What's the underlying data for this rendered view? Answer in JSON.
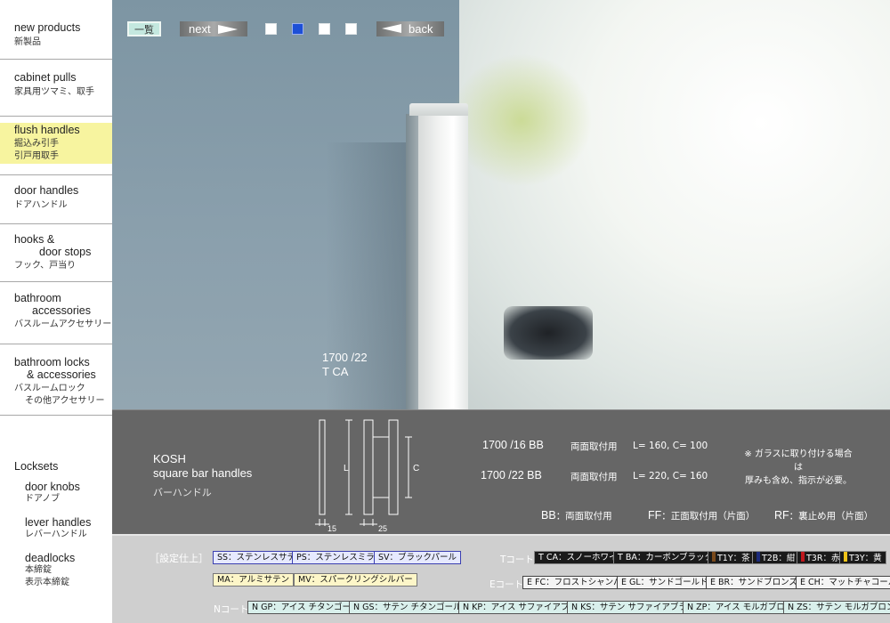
{
  "sidebar": {
    "items": [
      {
        "en": "new products",
        "jp": "新製品"
      },
      {
        "en": "cabinet pulls",
        "jp": "家具用ツマミ、取手"
      },
      {
        "en": "flush handles",
        "jp": "掘込み引手",
        "jp2": "引戸用取手"
      },
      {
        "en": "door handles",
        "jp": "ドアハンドル"
      },
      {
        "en": "hooks &",
        "en2": "door stops",
        "jp": "フック、戸当り"
      },
      {
        "en": "bathroom",
        "en2": "accessories",
        "jp": "バスルームアクセサリー"
      },
      {
        "en": "bathroom locks",
        "en2": "& accessories",
        "jp": "バスルームロック",
        "jp2": "その他アクセサリー"
      }
    ],
    "locksets": {
      "heading": "Locksets",
      "items": [
        {
          "en": "door knobs",
          "jp": "ドアノブ"
        },
        {
          "en": "lever handles",
          "jp": "レバーハンドル"
        },
        {
          "en": "deadlocks",
          "jp": "本締錠",
          "jp2": "表示本締錠"
        }
      ]
    }
  },
  "topnav": {
    "list_label": "一覧",
    "next_label": "next",
    "back_label": "back",
    "pages": 4,
    "active_page": 2
  },
  "hero": {
    "caption_line1": "1700 /22",
    "caption_line2": "T CA"
  },
  "product": {
    "name": "KOSH",
    "subtitle": "square bar handles",
    "jp": "バーハンドル",
    "diagram": {
      "label_l": "L",
      "label_c": "C",
      "dim_15": "15",
      "dim_25": "25"
    },
    "specs": [
      {
        "model": "1700 /16 BB",
        "mount": "両面取付用",
        "dims": "L= 160,   C= 100"
      },
      {
        "model": "1700 /22 BB",
        "mount": "両面取付用",
        "dims": "L= 220,   C= 160"
      }
    ],
    "note_line1": "※ ガラスに取り付ける場合は",
    "note_line2": "厚みも含め、指示が必要。",
    "legend": [
      {
        "key": "BB",
        "desc": "：両面取付用"
      },
      {
        "key": "FF",
        "desc": "：正面取付用（片面）"
      },
      {
        "key": "RF",
        "desc": "：裏止め用（片面）"
      }
    ]
  },
  "finishes": {
    "heading": "［設定仕上］",
    "standard": [
      {
        "label": "SS：ステンレスサテン",
        "style": "blue"
      },
      {
        "label": "PS：ステンレスミラー",
        "style": "blue"
      },
      {
        "label": "SV：ブラックパール",
        "style": "blue"
      },
      {
        "label": "MA：アルミサテン",
        "style": "yellow"
      },
      {
        "label": "MV：スパークリングシルバー",
        "style": "yellow"
      }
    ],
    "t_coat": {
      "label": "Tコート",
      "items": [
        {
          "label": "T CA：スノーホワイト",
          "chip": ""
        },
        {
          "label": "T BA：カーボンブラック",
          "chip": ""
        },
        {
          "label": "T1Y：茶",
          "chip": "#7a4a1c"
        },
        {
          "label": "T2B：紺",
          "chip": "#1b2a7a"
        },
        {
          "label": "T3R：赤",
          "chip": "#c0171d"
        },
        {
          "label": "T3Y：黄",
          "chip": "#f0c419"
        }
      ]
    },
    "e_coat": {
      "label": "Eコート",
      "items": [
        {
          "label": "E FC：フロストシャンパン"
        },
        {
          "label": "E GL：サンドゴールド"
        },
        {
          "label": "E BR：サンドブロンズ"
        },
        {
          "label": "E CH：マットチャコール"
        }
      ]
    },
    "n_coat": {
      "label": "Nコート",
      "items": [
        {
          "label": "N GP：アイス チタンゴールド"
        },
        {
          "label": "N GS：サテン チタンゴールド"
        },
        {
          "label": "N KP：アイス サファイアブラック"
        },
        {
          "label": "N KS：サテン サファイアブラック"
        },
        {
          "label": "N ZP：アイス モルガブロンズ"
        },
        {
          "label": "N ZS：サテン モルガブロンズ"
        }
      ]
    }
  },
  "colors": {
    "sidebar_highlight": "#f7f49f",
    "info_band": "#666666",
    "finish_band": "#cfcfcf",
    "active_page": "#1d4fd6"
  }
}
